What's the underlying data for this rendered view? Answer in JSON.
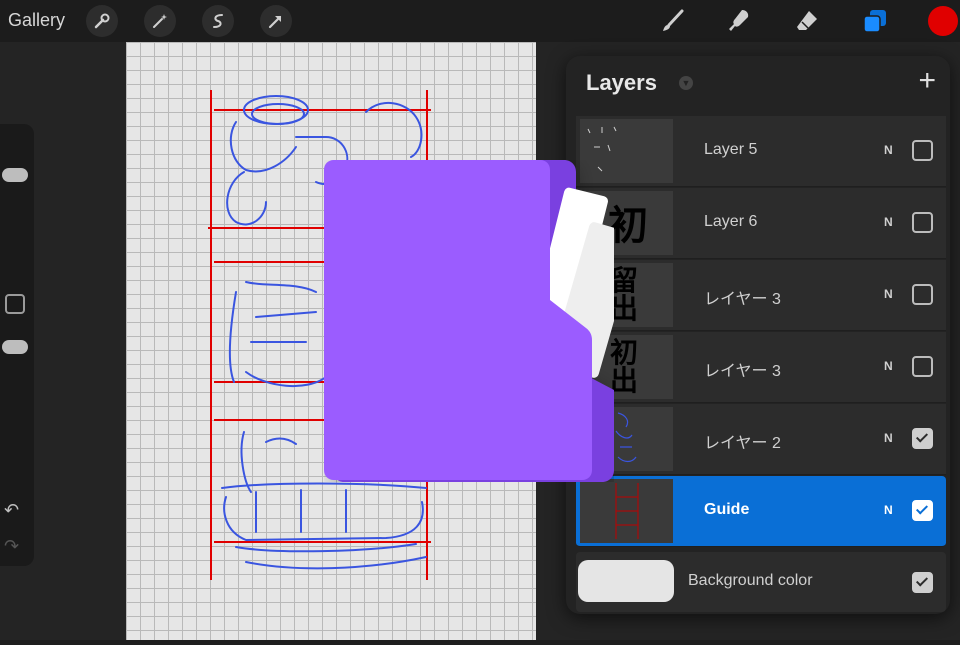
{
  "topbar": {
    "gallery_label": "Gallery",
    "left_tools": [
      "wrench-icon",
      "magic-wand-icon",
      "selection-icon",
      "transform-arrow-icon"
    ],
    "right_tools": [
      "brush-icon",
      "smudge-icon",
      "eraser-icon",
      "layers-icon"
    ],
    "color": "#e00000"
  },
  "layers_panel": {
    "title": "Layers",
    "add_label": "+",
    "layers": [
      {
        "name": "Layer 5",
        "blend": "N",
        "visible": false,
        "selected": false
      },
      {
        "name": "Layer 6",
        "blend": "N",
        "visible": false,
        "selected": false
      },
      {
        "name": "レイヤー 3",
        "blend": "N",
        "visible": false,
        "selected": false
      },
      {
        "name": "レイヤー 3",
        "blend": "N",
        "visible": false,
        "selected": false
      },
      {
        "name": "レイヤー 2",
        "blend": "N",
        "visible": true,
        "selected": false
      },
      {
        "name": "Guide",
        "blend": "N",
        "visible": true,
        "selected": true
      }
    ],
    "background": {
      "label": "Background color",
      "visible": true,
      "color": "#e5e5e5"
    }
  },
  "thumb_text": {
    "layer6": "初",
    "layer3a": "留出",
    "layer3b": "初出"
  },
  "colors": {
    "accent": "#0a6fd6",
    "folder": "#9b5cff",
    "sketch": "#3a55e0",
    "guide": "#e00000"
  }
}
